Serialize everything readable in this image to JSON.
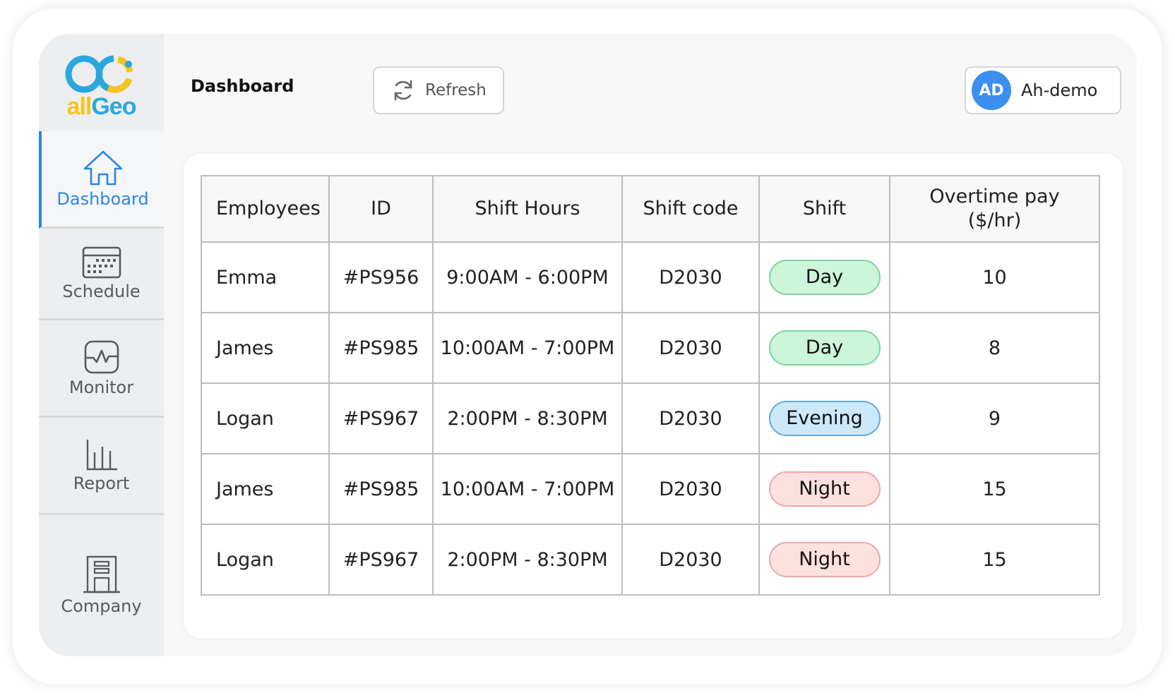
{
  "brand": {
    "logo_all": "all",
    "logo_geo": "Geo"
  },
  "header": {
    "title": "Dashboard",
    "refresh_label": "Refresh",
    "user": {
      "initials": "AD",
      "name": "Ah-demo"
    }
  },
  "sidebar": {
    "items": [
      {
        "label": "Dashboard",
        "icon": "home-icon",
        "active": true
      },
      {
        "label": "Schedule",
        "icon": "calendar-icon",
        "active": false
      },
      {
        "label": "Monitor",
        "icon": "pulse-monitor-icon",
        "active": false
      },
      {
        "label": "Report",
        "icon": "bar-chart-icon",
        "active": false
      },
      {
        "label": "Company",
        "icon": "building-icon",
        "active": false
      }
    ]
  },
  "table": {
    "columns": [
      "Employees",
      "ID",
      "Shift Hours",
      "Shift code",
      "Shift",
      "Overtime pay ($/hr)"
    ],
    "column_lines": {
      "overtime_line1": "Overtime pay",
      "overtime_line2": "($/hr)"
    },
    "rows": [
      {
        "employee": "Emma",
        "id": "#PS956",
        "hours": "9:00AM - 6:00PM",
        "code": "D2030",
        "shift": "Day",
        "shift_type": "day",
        "overtime": "10"
      },
      {
        "employee": "James",
        "id": "#PS985",
        "hours": "10:00AM - 7:00PM",
        "code": "D2030",
        "shift": "Day",
        "shift_type": "day",
        "overtime": "8"
      },
      {
        "employee": "Logan",
        "id": "#PS967",
        "hours": "2:00PM - 8:30PM",
        "code": "D2030",
        "shift": "Evening",
        "shift_type": "evening",
        "overtime": "9"
      },
      {
        "employee": "James",
        "id": "#PS985",
        "hours": "10:00AM - 7:00PM",
        "code": "D2030",
        "shift": "Night",
        "shift_type": "night",
        "overtime": "15"
      },
      {
        "employee": "Logan",
        "id": "#PS967",
        "hours": "2:00PM - 8:30PM",
        "code": "D2030",
        "shift": "Night",
        "shift_type": "night",
        "overtime": "15"
      }
    ]
  },
  "colors": {
    "accent": "#2b86e6",
    "avatar": "#3a8ff0",
    "day_pill": "#ccf5da",
    "evening_pill": "#cde9f9",
    "night_pill": "#fde0e0"
  }
}
